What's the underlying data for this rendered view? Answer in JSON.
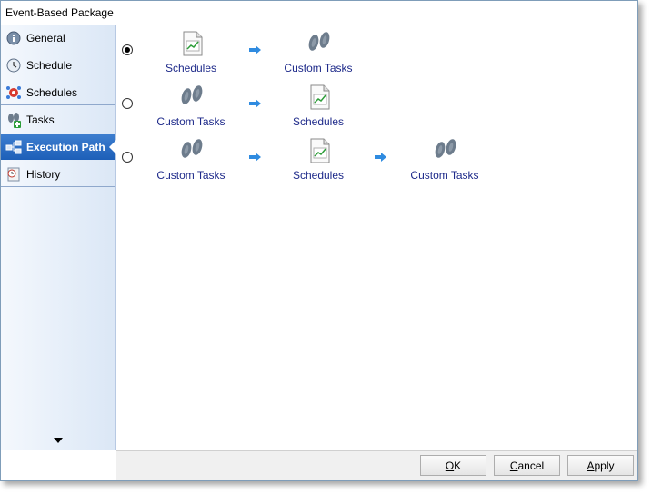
{
  "window": {
    "title": "Event-Based Package"
  },
  "sidebar": {
    "items": [
      {
        "label": "General",
        "icon": "info-icon"
      },
      {
        "label": "Schedule",
        "icon": "clock-icon"
      },
      {
        "label": "Schedules",
        "icon": "schedules-icon"
      },
      {
        "label": "Tasks",
        "icon": "tasks-icon"
      },
      {
        "label": "Execution Path",
        "icon": "execution-path-icon",
        "active": true
      },
      {
        "label": "History",
        "icon": "history-icon"
      }
    ]
  },
  "execution_paths": [
    {
      "selected": true,
      "steps": [
        "Schedules",
        "Custom Tasks"
      ]
    },
    {
      "selected": false,
      "steps": [
        "Custom Tasks",
        "Schedules"
      ]
    },
    {
      "selected": false,
      "steps": [
        "Custom Tasks",
        "Schedules",
        "Custom Tasks"
      ]
    }
  ],
  "footer": {
    "ok": {
      "accel": "O",
      "rest": "K"
    },
    "cancel": {
      "accel": "C",
      "rest": "ancel"
    },
    "apply": {
      "accel": "A",
      "rest": "pply"
    }
  },
  "colors": {
    "accent": "#1d5fb8",
    "link_text": "#1e2a8a",
    "arrow": "#2f8be0"
  }
}
